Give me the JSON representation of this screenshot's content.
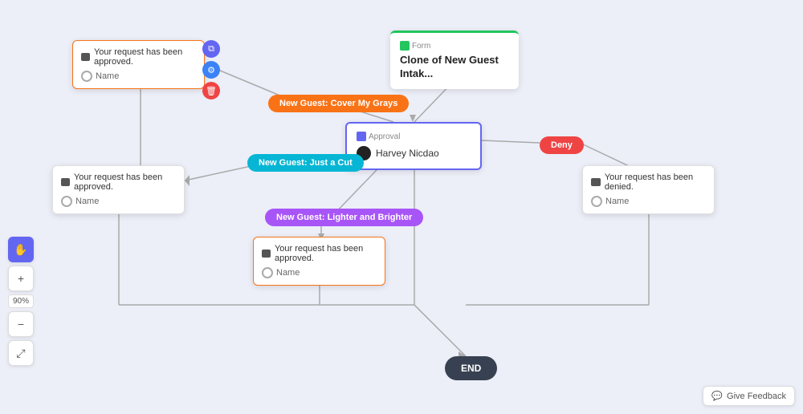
{
  "canvas": {
    "background": "#eceef8"
  },
  "nodes": {
    "form": {
      "type_label": "Form",
      "title": "Clone of New Guest Intak..."
    },
    "approval": {
      "type_label": "Approval",
      "assignee": "Harvey Nicdao"
    },
    "msg_topleft": {
      "header": "Your request has been approved.",
      "name_label": "Name"
    },
    "msg_midleft": {
      "header": "Your request has been approved.",
      "name_label": "Name"
    },
    "msg_bottom": {
      "header": "Your request has been approved.",
      "name_label": "Name"
    },
    "msg_right": {
      "header": "Your request has been denied.",
      "name_label": "Name"
    },
    "end": {
      "label": "END"
    }
  },
  "pills": {
    "orange": "New Guest: Cover My Grays",
    "teal": "New Guest: Just a Cut",
    "purple": "New Guest: Lighter and Brighter",
    "red": "Deny"
  },
  "toolbar": {
    "hand_tool": "✋",
    "zoom_in": "+",
    "zoom_level": "90%",
    "zoom_out": "−",
    "fullscreen": "⤢"
  },
  "action_buttons": {
    "copy": "⧉",
    "settings": "⚙",
    "delete": "🗑"
  },
  "feedback": {
    "label": "Give Feedback"
  }
}
